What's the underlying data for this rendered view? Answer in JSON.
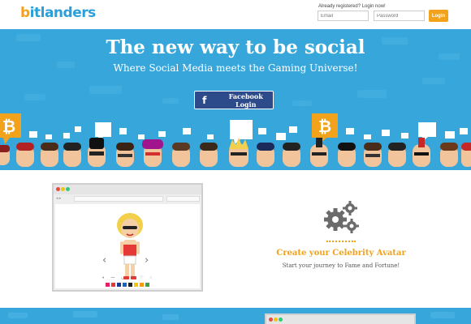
{
  "header": {
    "logo_text": "bitlanders",
    "login_note": "Already registered? Login now!",
    "email_placeholder": "Email",
    "password_placeholder": "Password",
    "login_label": "Login"
  },
  "hero": {
    "title": "The new way to be social",
    "subtitle": "Where Social Media meets the Gaming Universe!",
    "facebook_label": "Facebook Login",
    "facebook_icon": "facebook-icon",
    "bitcoin_icon": "bitcoin-icon",
    "background_color": "#37a6db"
  },
  "avatar_section": {
    "title": "Create your Celebrity Avatar",
    "subtitle": "Start your journey to Fame and Fortune!",
    "icon": "gears-icon",
    "swatches": [
      "#e91e63",
      "#e53935",
      "#1e3a8a",
      "#1565c0",
      "#222222",
      "#f1c40f",
      "#f39c12",
      "#43a047"
    ]
  },
  "colors": {
    "accent": "#f3a21b",
    "brand_blue": "#2b9fd9",
    "facebook_blue": "#2d4a8a"
  }
}
